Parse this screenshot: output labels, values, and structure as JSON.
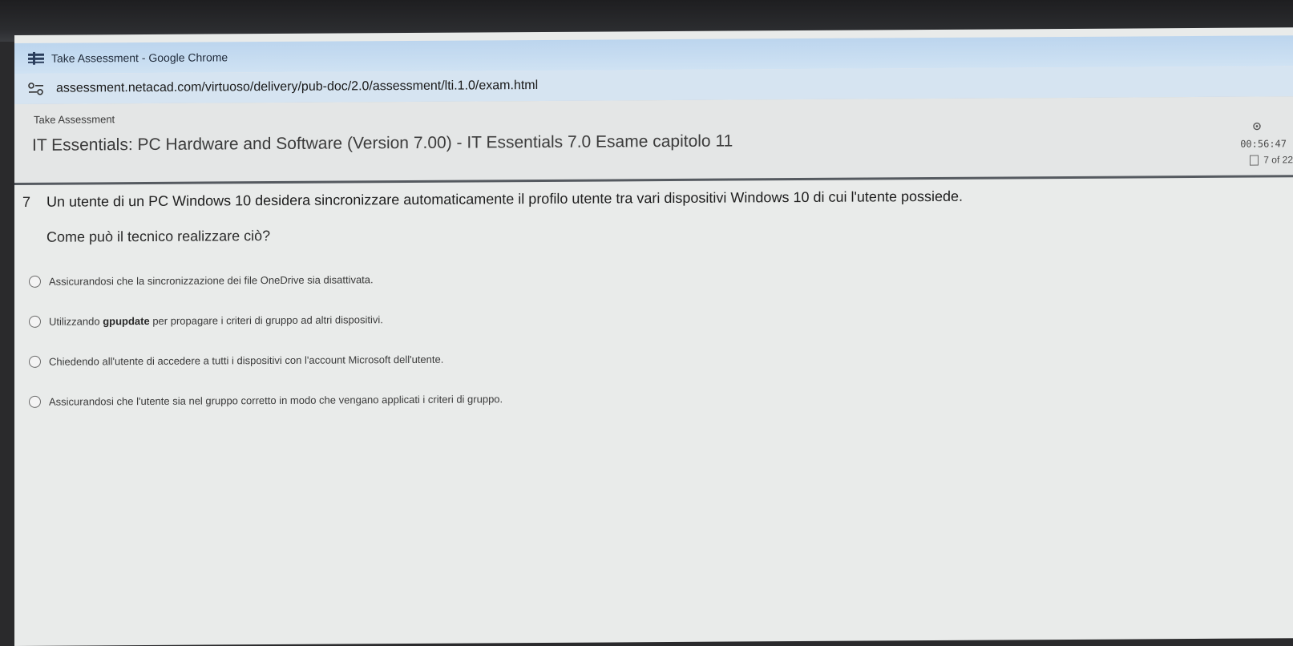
{
  "browser": {
    "window_title": "Take Assessment - Google Chrome",
    "url": "assessment.netacad.com/virtuoso/delivery/pub-doc/2.0/assessment/lti.1.0/exam.html"
  },
  "header": {
    "breadcrumb": "Take Assessment",
    "exam_title": "IT Essentials: PC Hardware and Software (Version 7.00) - IT Essentials 7.0 Esame capitolo 11",
    "timer": "00:56:47",
    "progress": "7 of 22"
  },
  "question": {
    "number": "7",
    "text_line1": "Un utente di un PC Windows 10 desidera sincronizzare automaticamente il profilo utente tra vari dispositivi Windows 10 di cui l'utente possiede.",
    "text_line2": "Come può il tecnico realizzare ciò?"
  },
  "answers": [
    {
      "text": "Assicurandosi che la sincronizzazione dei file OneDrive sia disattivata."
    },
    {
      "pre": "Utilizzando ",
      "bold": "gpupdate",
      "post": " per propagare i criteri di gruppo ad altri dispositivi."
    },
    {
      "text": "Chiedendo all'utente di accedere a tutti i dispositivi con l'account Microsoft dell'utente."
    },
    {
      "text": "Assicurandosi che l'utente sia nel gruppo corretto in modo che vengano applicati i criteri di gruppo."
    }
  ]
}
